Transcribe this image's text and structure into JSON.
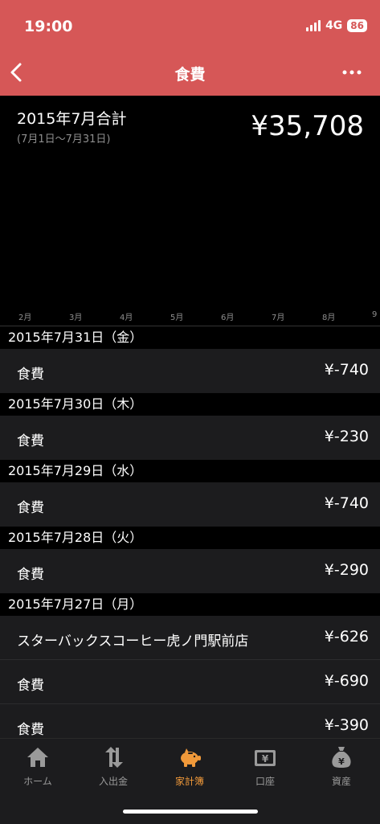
{
  "status": {
    "time": "19:00",
    "network": "4G",
    "battery": "86"
  },
  "nav": {
    "title": "食費"
  },
  "summary": {
    "title": "2015年7月合計",
    "range": "(7月1日〜7月31日)",
    "total": "¥35,708"
  },
  "months": [
    "2月",
    "3月",
    "4月",
    "5月",
    "6月",
    "7月",
    "8月",
    "9"
  ],
  "groups": [
    {
      "date": "2015年7月31日（金）",
      "items": [
        {
          "name": "食費",
          "amount": "¥-740"
        }
      ]
    },
    {
      "date": "2015年7月30日（木）",
      "items": [
        {
          "name": "食費",
          "amount": "¥-230"
        }
      ]
    },
    {
      "date": "2015年7月29日（水）",
      "items": [
        {
          "name": "食費",
          "amount": "¥-740"
        }
      ]
    },
    {
      "date": "2015年7月28日（火）",
      "items": [
        {
          "name": "食費",
          "amount": "¥-290"
        }
      ]
    },
    {
      "date": "2015年7月27日（月）",
      "items": [
        {
          "name": "スターバックスコーヒー虎ノ門駅前店",
          "amount": "¥-626"
        },
        {
          "name": "食費",
          "amount": "¥-690"
        },
        {
          "name": "食費",
          "amount": "¥-390"
        }
      ]
    }
  ],
  "tabs": [
    {
      "label": "ホーム",
      "icon": "home-icon"
    },
    {
      "label": "入出金",
      "icon": "transfer-arrows-icon"
    },
    {
      "label": "家計簿",
      "icon": "piggy-bank-icon",
      "active": true
    },
    {
      "label": "口座",
      "icon": "wallet-yen-icon"
    },
    {
      "label": "資産",
      "icon": "money-bag-icon"
    }
  ],
  "colors": {
    "header": "#d65757",
    "active_tab": "#f0993a",
    "row_bg": "#1c1c1e"
  }
}
